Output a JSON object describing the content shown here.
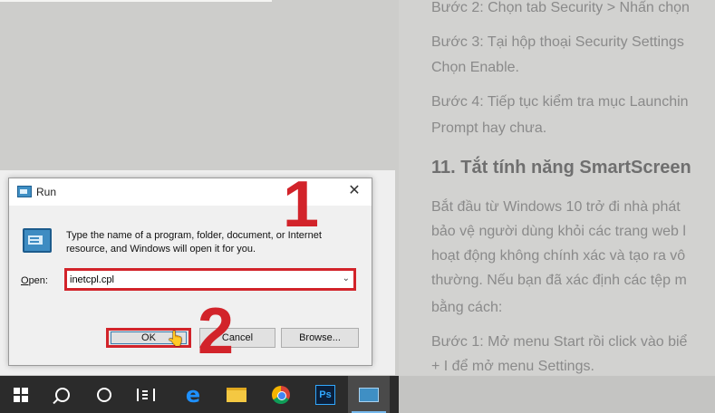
{
  "article": {
    "lines": [
      "Bước 2: Chọn tab Security > Nhấn chọn",
      "Bước 3: Tại hộp thoại Security Settings",
      "Chọn Enable.",
      "Bước 4: Tiếp tục kiểm tra mục Launchin",
      "Prompt hay chưa.",
      "11. Tắt tính năng SmartScreen",
      "Bắt đầu từ Windows 10 trở đi nhà phát",
      "bảo vệ người dùng khỏi các trang web l",
      "hoạt động không chính xác và tạo ra vô",
      "thường. Nếu bạn đã xác định các tệp m",
      "bằng cách:",
      "Bước 1: Mở menu Start rồi click vào biể",
      "+ I để mở menu Settings."
    ]
  },
  "dialog": {
    "title": "Run",
    "close_glyph": "✕",
    "description": "Type the name of a program, folder, document, or Internet resource, and Windows will open it for you.",
    "open_label_underlined": "O",
    "open_label_rest": "pen:",
    "open_value": "inetcpl.cpl",
    "ok_label": "OK",
    "cancel_label": "Cancel",
    "browse_label": "Browse..."
  },
  "annotations": {
    "step1": "1",
    "step2": "2",
    "color": "#d2232a"
  },
  "taskbar": {
    "items": [
      "windows-start",
      "search",
      "cortana",
      "task-view",
      "edge",
      "file-explorer",
      "chrome",
      "photoshop",
      "run"
    ],
    "ps_label": "Ps",
    "edge_glyph": "e"
  }
}
